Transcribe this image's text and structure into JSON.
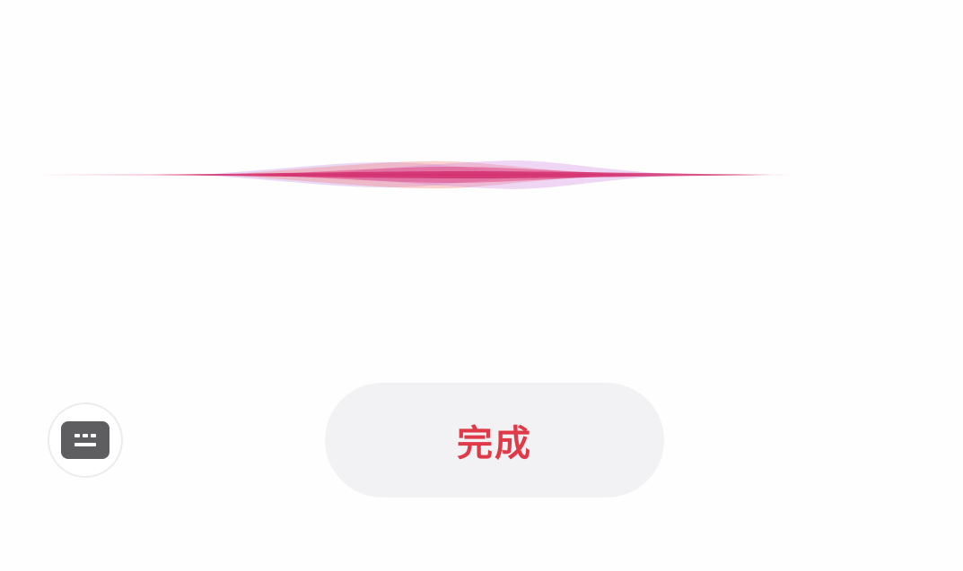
{
  "voice_input": {
    "waveform_icon": "siri-waveform",
    "waveform_colors": [
      "#e0306e",
      "#b873e0",
      "#f27a6e",
      "#d27ae0"
    ]
  },
  "keyboard_toggle": {
    "icon": "keyboard-icon",
    "icon_color": "#5e5e60"
  },
  "done_button": {
    "label": "完成",
    "label_color": "#e03a49",
    "background": "#f2f2f4"
  }
}
